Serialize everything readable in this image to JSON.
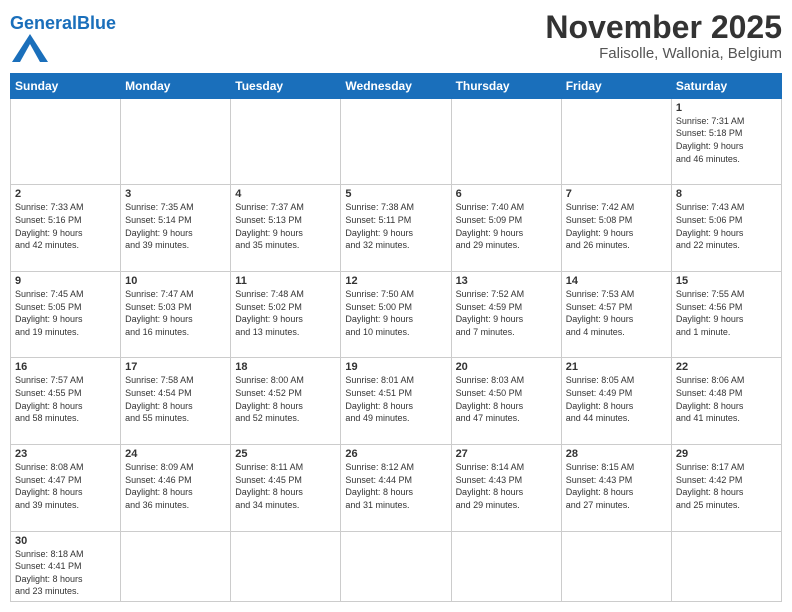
{
  "header": {
    "logo_general": "General",
    "logo_blue": "Blue",
    "month": "November 2025",
    "location": "Falisolle, Wallonia, Belgium"
  },
  "weekdays": [
    "Sunday",
    "Monday",
    "Tuesday",
    "Wednesday",
    "Thursday",
    "Friday",
    "Saturday"
  ],
  "weeks": [
    [
      {
        "day": "",
        "info": ""
      },
      {
        "day": "",
        "info": ""
      },
      {
        "day": "",
        "info": ""
      },
      {
        "day": "",
        "info": ""
      },
      {
        "day": "",
        "info": ""
      },
      {
        "day": "",
        "info": ""
      },
      {
        "day": "1",
        "info": "Sunrise: 7:31 AM\nSunset: 5:18 PM\nDaylight: 9 hours\nand 46 minutes."
      }
    ],
    [
      {
        "day": "2",
        "info": "Sunrise: 7:33 AM\nSunset: 5:16 PM\nDaylight: 9 hours\nand 42 minutes."
      },
      {
        "day": "3",
        "info": "Sunrise: 7:35 AM\nSunset: 5:14 PM\nDaylight: 9 hours\nand 39 minutes."
      },
      {
        "day": "4",
        "info": "Sunrise: 7:37 AM\nSunset: 5:13 PM\nDaylight: 9 hours\nand 35 minutes."
      },
      {
        "day": "5",
        "info": "Sunrise: 7:38 AM\nSunset: 5:11 PM\nDaylight: 9 hours\nand 32 minutes."
      },
      {
        "day": "6",
        "info": "Sunrise: 7:40 AM\nSunset: 5:09 PM\nDaylight: 9 hours\nand 29 minutes."
      },
      {
        "day": "7",
        "info": "Sunrise: 7:42 AM\nSunset: 5:08 PM\nDaylight: 9 hours\nand 26 minutes."
      },
      {
        "day": "8",
        "info": "Sunrise: 7:43 AM\nSunset: 5:06 PM\nDaylight: 9 hours\nand 22 minutes."
      }
    ],
    [
      {
        "day": "9",
        "info": "Sunrise: 7:45 AM\nSunset: 5:05 PM\nDaylight: 9 hours\nand 19 minutes."
      },
      {
        "day": "10",
        "info": "Sunrise: 7:47 AM\nSunset: 5:03 PM\nDaylight: 9 hours\nand 16 minutes."
      },
      {
        "day": "11",
        "info": "Sunrise: 7:48 AM\nSunset: 5:02 PM\nDaylight: 9 hours\nand 13 minutes."
      },
      {
        "day": "12",
        "info": "Sunrise: 7:50 AM\nSunset: 5:00 PM\nDaylight: 9 hours\nand 10 minutes."
      },
      {
        "day": "13",
        "info": "Sunrise: 7:52 AM\nSunset: 4:59 PM\nDaylight: 9 hours\nand 7 minutes."
      },
      {
        "day": "14",
        "info": "Sunrise: 7:53 AM\nSunset: 4:57 PM\nDaylight: 9 hours\nand 4 minutes."
      },
      {
        "day": "15",
        "info": "Sunrise: 7:55 AM\nSunset: 4:56 PM\nDaylight: 9 hours\nand 1 minute."
      }
    ],
    [
      {
        "day": "16",
        "info": "Sunrise: 7:57 AM\nSunset: 4:55 PM\nDaylight: 8 hours\nand 58 minutes."
      },
      {
        "day": "17",
        "info": "Sunrise: 7:58 AM\nSunset: 4:54 PM\nDaylight: 8 hours\nand 55 minutes."
      },
      {
        "day": "18",
        "info": "Sunrise: 8:00 AM\nSunset: 4:52 PM\nDaylight: 8 hours\nand 52 minutes."
      },
      {
        "day": "19",
        "info": "Sunrise: 8:01 AM\nSunset: 4:51 PM\nDaylight: 8 hours\nand 49 minutes."
      },
      {
        "day": "20",
        "info": "Sunrise: 8:03 AM\nSunset: 4:50 PM\nDaylight: 8 hours\nand 47 minutes."
      },
      {
        "day": "21",
        "info": "Sunrise: 8:05 AM\nSunset: 4:49 PM\nDaylight: 8 hours\nand 44 minutes."
      },
      {
        "day": "22",
        "info": "Sunrise: 8:06 AM\nSunset: 4:48 PM\nDaylight: 8 hours\nand 41 minutes."
      }
    ],
    [
      {
        "day": "23",
        "info": "Sunrise: 8:08 AM\nSunset: 4:47 PM\nDaylight: 8 hours\nand 39 minutes."
      },
      {
        "day": "24",
        "info": "Sunrise: 8:09 AM\nSunset: 4:46 PM\nDaylight: 8 hours\nand 36 minutes."
      },
      {
        "day": "25",
        "info": "Sunrise: 8:11 AM\nSunset: 4:45 PM\nDaylight: 8 hours\nand 34 minutes."
      },
      {
        "day": "26",
        "info": "Sunrise: 8:12 AM\nSunset: 4:44 PM\nDaylight: 8 hours\nand 31 minutes."
      },
      {
        "day": "27",
        "info": "Sunrise: 8:14 AM\nSunset: 4:43 PM\nDaylight: 8 hours\nand 29 minutes."
      },
      {
        "day": "28",
        "info": "Sunrise: 8:15 AM\nSunset: 4:43 PM\nDaylight: 8 hours\nand 27 minutes."
      },
      {
        "day": "29",
        "info": "Sunrise: 8:17 AM\nSunset: 4:42 PM\nDaylight: 8 hours\nand 25 minutes."
      }
    ],
    [
      {
        "day": "30",
        "info": "Sunrise: 8:18 AM\nSunset: 4:41 PM\nDaylight: 8 hours\nand 23 minutes."
      },
      {
        "day": "",
        "info": ""
      },
      {
        "day": "",
        "info": ""
      },
      {
        "day": "",
        "info": ""
      },
      {
        "day": "",
        "info": ""
      },
      {
        "day": "",
        "info": ""
      },
      {
        "day": "",
        "info": ""
      }
    ]
  ]
}
